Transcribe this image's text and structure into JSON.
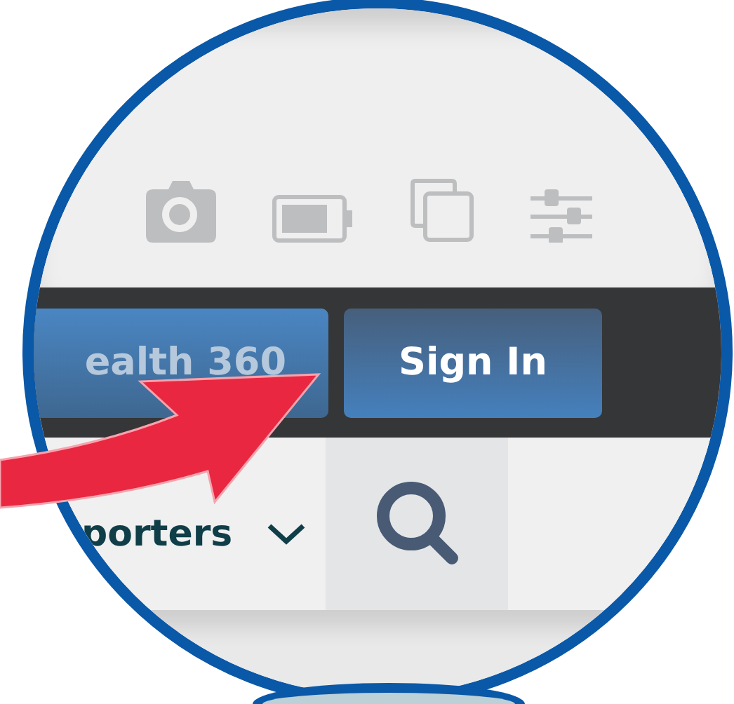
{
  "nav_buttons": [
    {
      "label": "ealth 360",
      "selected": false
    },
    {
      "label": "Sign In",
      "selected": true
    }
  ],
  "menu": {
    "label": "porters",
    "kind": "dropdown"
  }
}
